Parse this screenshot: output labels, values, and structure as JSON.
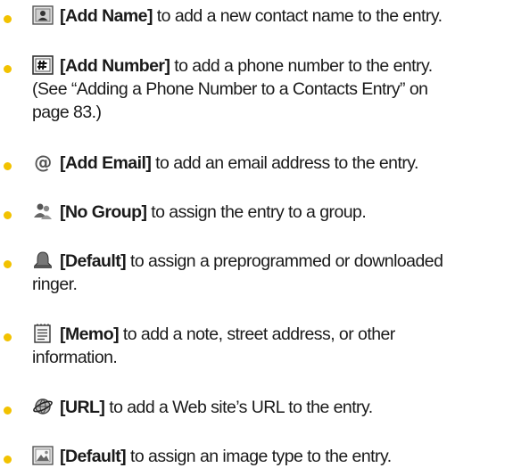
{
  "items": [
    {
      "icon": "add-name-icon",
      "label": "[Add Name]",
      "text": " to add a new contact name to the entry.",
      "continuation": []
    },
    {
      "icon": "add-number-icon",
      "label": "[Add Number]",
      "text": " to add a phone number to the entry.",
      "continuation": [
        "(See “Adding a Phone Number to a Contacts Entry” on",
        "page 83.)"
      ]
    },
    {
      "icon": "add-email-icon",
      "label": "[Add Email]",
      "text": " to add an email address to the entry.",
      "continuation": []
    },
    {
      "icon": "group-icon",
      "label": "[No Group]",
      "text": " to assign the entry to a group.",
      "continuation": []
    },
    {
      "icon": "ringer-icon",
      "label": "[Default]",
      "text": " to assign a preprogrammed or downloaded",
      "continuation": [
        "ringer."
      ]
    },
    {
      "icon": "memo-icon",
      "label": "[Memo]",
      "text": " to add a note, street address, or other",
      "continuation": [
        "information."
      ]
    },
    {
      "icon": "url-icon",
      "label": "[URL]",
      "text": " to add a Web site’s URL to the entry.",
      "continuation": []
    },
    {
      "icon": "image-icon",
      "label": "[Default]",
      "text": " to assign an image type to the entry.",
      "continuation": []
    }
  ],
  "colors": {
    "bullet": "#f2c200",
    "text": "#1a1a1a"
  }
}
